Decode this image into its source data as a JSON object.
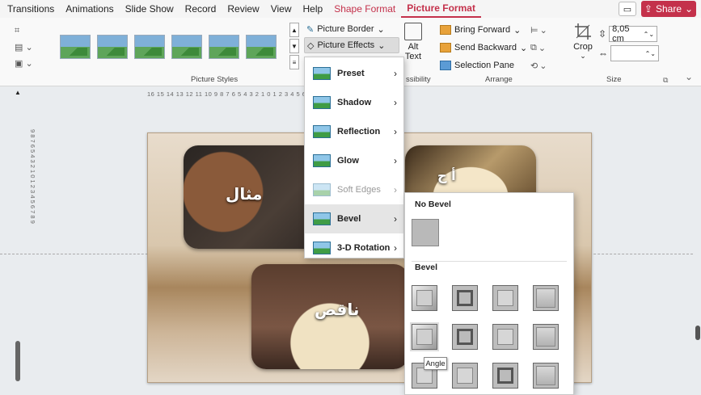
{
  "menubar": {
    "tabs": [
      "Transitions",
      "Animations",
      "Slide Show",
      "Record",
      "Review",
      "View",
      "Help"
    ],
    "contextual": [
      "Shape Format"
    ],
    "active": "Picture Format",
    "share": "Share"
  },
  "ribbon": {
    "picture_styles_label": "Picture Styles",
    "picture_border": "Picture Border",
    "picture_effects": "Picture Effects",
    "alt_text": "Alt Text",
    "accessibility_label": "ssibility",
    "arrange": {
      "bring_forward": "Bring Forward",
      "send_backward": "Send Backward",
      "selection_pane": "Selection Pane",
      "label": "Arrange"
    },
    "crop": "Crop",
    "size": {
      "height": "8,05 cm",
      "width": "",
      "label": "Size"
    }
  },
  "rulers": {
    "horizontal": "16 15 14 13 12 11 10 9 8 7 6 5 4 3 2 1 0 1 2 3 4 5 6 7 8 9 10 11 12 13 14 15 16",
    "vertical": "9 8 7 6 5 4 3 2 1 0 1 2 3 4 5 6 7 8 9"
  },
  "slide": {
    "word1": "مثال",
    "word2": "أ ح",
    "word3": "ناقص"
  },
  "effects_menu": {
    "items": [
      {
        "label": "Preset"
      },
      {
        "label": "Shadow"
      },
      {
        "label": "Reflection"
      },
      {
        "label": "Glow"
      },
      {
        "label": "Soft Edges"
      },
      {
        "label": "Bevel"
      },
      {
        "label": "3-D Rotation"
      }
    ]
  },
  "bevel_menu": {
    "no_bevel": "No Bevel",
    "bevel": "Bevel",
    "tooltip": "Angle"
  },
  "colors": {
    "accent": "#c4314b"
  }
}
